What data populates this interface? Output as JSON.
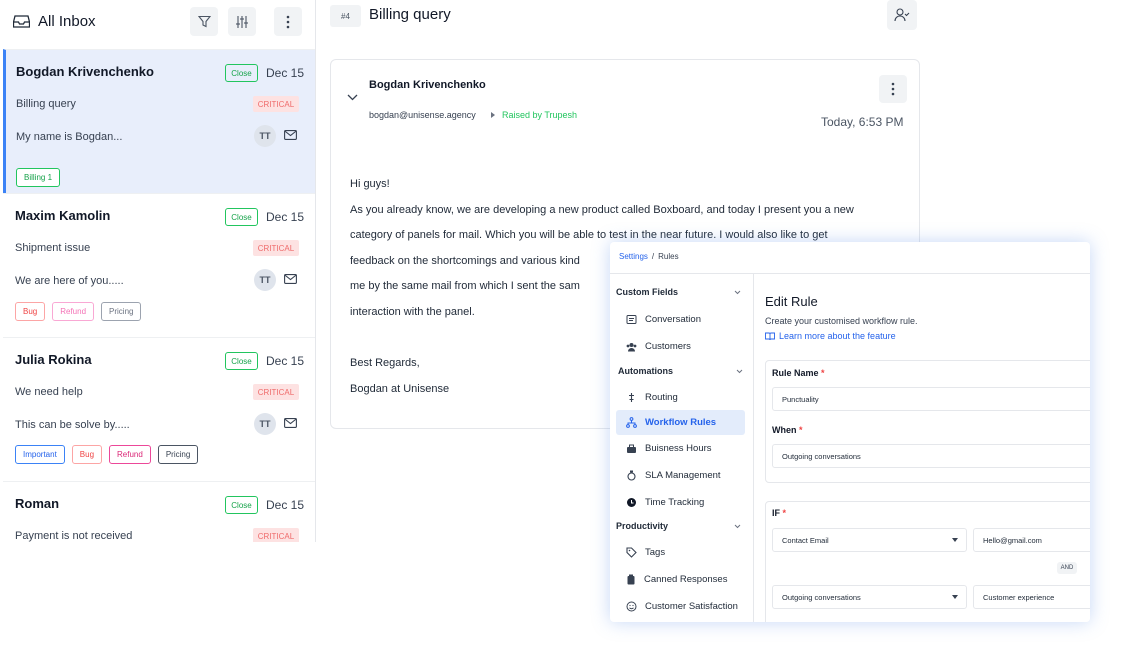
{
  "inbox": {
    "title": "All Inbox",
    "conversations": [
      {
        "name": "Bogdan Krivenchenko",
        "status": "Close",
        "date": "Dec 15",
        "subject": "Billing query",
        "priority": "CRITICAL",
        "preview": "My name is Bogdan...",
        "avatar": "TT",
        "tags": [
          "Billing 1"
        ]
      },
      {
        "name": "Maxim Kamolin",
        "status": "Close",
        "date": "Dec 15",
        "subject": "Shipment issue",
        "priority": "CRITICAL",
        "preview": "We are here of you.....",
        "avatar": "TT",
        "tags": [
          "Bug",
          "Refund",
          "Pricing"
        ]
      },
      {
        "name": "Julia Rokina",
        "status": "Close",
        "date": "Dec 15",
        "subject": "We need help",
        "priority": "CRITICAL",
        "preview": "This can be solve by.....",
        "avatar": "TT",
        "tags": [
          "Important",
          "Bug",
          "Refund",
          "Pricing"
        ]
      },
      {
        "name": "Roman",
        "status": "Close",
        "date": "Dec 15",
        "subject": "Payment is not received",
        "priority": "CRITICAL"
      }
    ]
  },
  "conversation": {
    "number": "#4",
    "title": "Billing query",
    "message": {
      "from_name": "Bogdan Krivenchenko",
      "from_email": "bogdan@unisense.agency",
      "raised_by": "Raised by Trupesh",
      "time": "Today, 6:53 PM",
      "greeting": "Hi guys!",
      "line1": "As you already know, we are developing a new product called Boxboard, and today I present you a new",
      "line2": "category of panels for mail. Which you will be able to test in the near future. I would also like to get",
      "line3": "feedback on the shortcomings and various kind",
      "line4": "me by the same mail from which I sent the sam",
      "line5": "interaction with the panel.",
      "signoff": "Best Regards,",
      "signature": "Bogdan at Unisense"
    }
  },
  "settings": {
    "breadcrumb": {
      "parent": "Settings",
      "separator": "/",
      "current": "Rules"
    },
    "sections": {
      "custom_fields": "Custom Fields",
      "automations": "Automations",
      "productivity": "Productivity"
    },
    "nav": {
      "conversation": "Conversation",
      "customers": "Customers",
      "routing": "Routing",
      "workflow_rules": "Workflow Rules",
      "business_hours": "Buisness Hours",
      "sla": "SLA Management",
      "time_tracking": "Time Tracking",
      "tags": "Tags",
      "canned": "Canned Responses",
      "csat": "Customer Satisfaction"
    },
    "edit": {
      "title": "Edit Rule",
      "subtitle": "Create your customised workflow rule.",
      "learn_more": "Learn more about the feature",
      "rule_name_label": "Rule Name",
      "rule_name_value": "Punctuality",
      "when_label": "When",
      "when_value": "Outgoing conversations",
      "if_label": "IF",
      "required": "*",
      "cond1_field": "Contact Email",
      "cond1_value": "Hello@gmail.com",
      "and_label": "AND",
      "cond2_field": "Outgoing conversations",
      "cond2_value": "Customer experience"
    }
  },
  "colors": {
    "accent": "#2563eb",
    "success": "#22c55e",
    "critical_bg": "#fde2e2",
    "critical_text": "#ef6b6b",
    "active_row": "#e8eefb"
  }
}
